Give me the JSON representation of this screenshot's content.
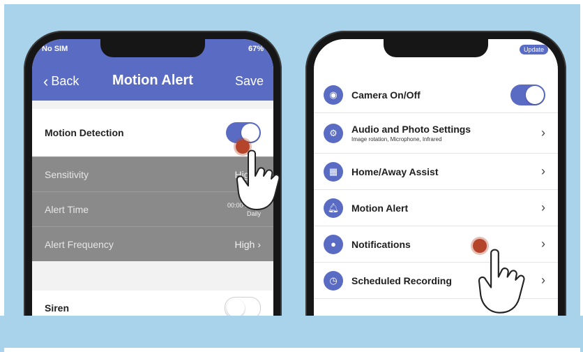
{
  "left_phone": {
    "status": {
      "carrier": "No SIM",
      "battery": "67%"
    },
    "nav": {
      "back_label": "Back",
      "title": "Motion Alert",
      "save_label": "Save"
    },
    "rows": [
      {
        "label": "Motion Detection",
        "toggle": "on"
      },
      {
        "label": "Sensitivity",
        "value": "High"
      },
      {
        "label": "Alert Time",
        "value_line1": "00:00-23:59",
        "value_line2": "Daily"
      },
      {
        "label": "Alert Frequency",
        "value": "High"
      },
      {
        "label": "Siren",
        "toggle": "off"
      }
    ]
  },
  "right_phone": {
    "update_label": "Update",
    "rows": [
      {
        "label": "Camera On/Off",
        "icon": "camera-icon",
        "toggle": "on"
      },
      {
        "label": "Audio and Photo Settings",
        "sub": "Image rotation, Microphone, Infrared",
        "icon": "settings-icon"
      },
      {
        "label": "Home/Away Assist",
        "icon": "home-grid-icon"
      },
      {
        "label": "Motion Alert",
        "icon": "bell-icon"
      },
      {
        "label": "Notifications",
        "icon": "notification-icon"
      },
      {
        "label": "Scheduled Recording",
        "icon": "clock-icon"
      }
    ]
  },
  "colors": {
    "accent": "#5a6bc4",
    "backdrop": "#a9d3ea",
    "tap": "#b5452a"
  }
}
